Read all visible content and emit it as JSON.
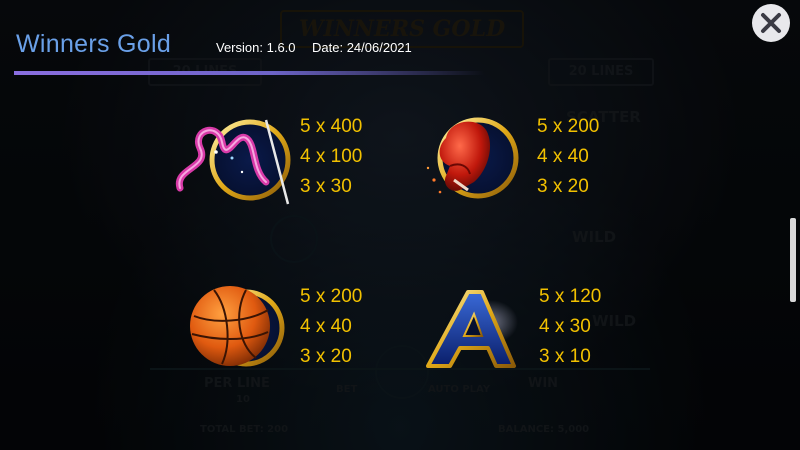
{
  "header": {
    "title": "Winners Gold",
    "version_label": "Version:",
    "version_value": "1.6.0",
    "date_label": "Date:",
    "date_value": "24/06/2021"
  },
  "close_icon": "close-icon",
  "accent_colors": {
    "title": "#6aa0e8",
    "payout": "#f2c100",
    "underline": "#8a6ee0"
  },
  "paytable": [
    {
      "symbol": "ribbon",
      "payouts": [
        "5 x 400",
        "4 x 100",
        "3 x 30"
      ]
    },
    {
      "symbol": "boxing-glove",
      "payouts": [
        "5 x 200",
        "4 x 40",
        "3 x 20"
      ]
    },
    {
      "symbol": "basketball",
      "payouts": [
        "5 x 200",
        "4 x 40",
        "3 x 20"
      ]
    },
    {
      "symbol": "letter-a",
      "payouts": [
        "5 x 120",
        "4 x 30",
        "3 x 10"
      ]
    }
  ],
  "background_game": {
    "logo": "WINNERS GOLD",
    "lines_left": "20 LINES",
    "lines_right": "20 LINES",
    "scatter": "SCATTER",
    "wild_1": "WILD",
    "wild_2": "WILD",
    "per_line_label": "PER LINE",
    "per_line_value": "10",
    "bet_label": "BET",
    "autoplay_label": "AUTO PLAY",
    "win_label": "WIN",
    "total_bet": "TOTAL BET: 200",
    "balance": "BALANCE: 5,000"
  }
}
